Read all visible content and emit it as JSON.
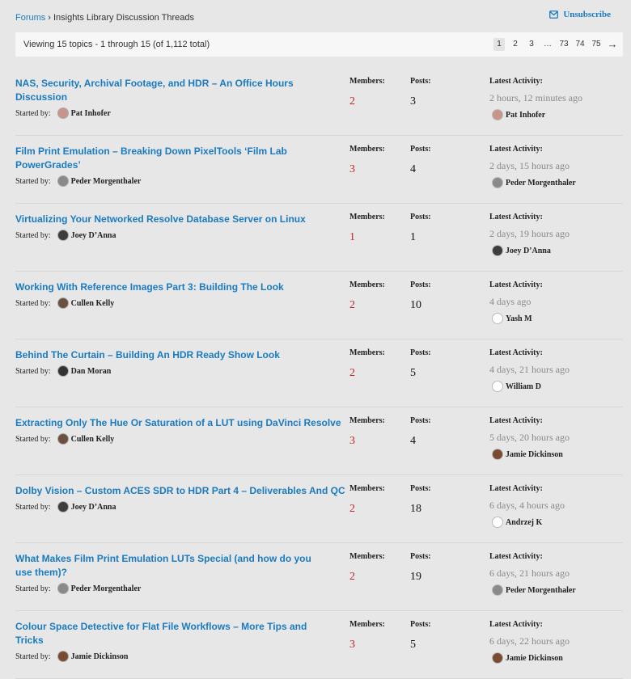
{
  "breadcrumb": {
    "root": "Forums",
    "separator": "›",
    "current": "Insights Library Discussion Threads"
  },
  "subscribe": {
    "label": "Unsubscribe"
  },
  "pagination": {
    "summary": "Viewing 15 topics - 1 through 15 (of 1,112 total)",
    "pages": [
      "1",
      "2",
      "3",
      "…",
      "73",
      "74",
      "75"
    ],
    "current": "1",
    "next": "→"
  },
  "columns": {
    "started_by": "Started by:",
    "members": "Members:",
    "posts": "Posts:",
    "latest": "Latest Activity:"
  },
  "colors": {
    "link": "#1a7bc0",
    "members": "#c0262c",
    "muted": "#8a8a8a"
  },
  "topics": [
    {
      "title": "NAS, Security, Archival Footage, and HDR – An Office Hours Discussion",
      "starter": "Pat Inhofer",
      "starter_avatar": "#c9948a",
      "members": "2",
      "posts": "3",
      "last_time": "2 hours, 12 minutes ago",
      "last_user": "Pat Inhofer",
      "last_avatar": "#c9948a"
    },
    {
      "title": "Film Print Emulation – Breaking Down PixelTools ‘Film Lab PowerGrades’",
      "starter": "Peder Morgenthaler",
      "starter_avatar": "#8a8a8a",
      "members": "3",
      "posts": "4",
      "last_time": "2 days, 15 hours ago",
      "last_user": "Peder Morgenthaler",
      "last_avatar": "#8a8a8a"
    },
    {
      "title": "Virtualizing Your Networked Resolve Database Server on Linux",
      "starter": "Joey D’Anna",
      "starter_avatar": "#3d3d3d",
      "members": "1",
      "posts": "1",
      "last_time": "2 days, 19 hours ago",
      "last_user": "Joey D’Anna",
      "last_avatar": "#3d3d3d"
    },
    {
      "title": "Working With Reference Images Part 3: Building The Look",
      "starter": "Cullen Kelly",
      "starter_avatar": "#6b5040",
      "members": "2",
      "posts": "10",
      "last_time": "4 days ago",
      "last_user": "Yash M",
      "last_avatar": "#ffffff"
    },
    {
      "title": "Behind The Curtain – Building An HDR Ready Show Look",
      "starter": "Dan Moran",
      "starter_avatar": "#333333",
      "members": "2",
      "posts": "5",
      "last_time": "4 days, 21 hours ago",
      "last_user": "William D",
      "last_avatar": "#ffffff"
    },
    {
      "title": "Extracting Only The Hue Or Saturation of a LUT using DaVinci Resolve",
      "starter": "Cullen Kelly",
      "starter_avatar": "#6b5040",
      "members": "3",
      "posts": "4",
      "last_time": "5 days, 20 hours ago",
      "last_user": "Jamie Dickinson",
      "last_avatar": "#7a4a32"
    },
    {
      "title": "Dolby Vision – Custom ACES SDR to HDR Part 4 – Deliverables And QC",
      "starter": "Joey D’Anna",
      "starter_avatar": "#3d3d3d",
      "members": "2",
      "posts": "18",
      "last_time": "6 days, 4 hours ago",
      "last_user": "Andrzej K",
      "last_avatar": "#ffffff"
    },
    {
      "title": "What Makes Film Print Emulation LUTs Special (and how do you use them)?",
      "starter": "Peder Morgenthaler",
      "starter_avatar": "#8a8a8a",
      "members": "2",
      "posts": "19",
      "last_time": "6 days, 21 hours ago",
      "last_user": "Peder Morgenthaler",
      "last_avatar": "#8a8a8a"
    },
    {
      "title": "Colour Space Detective for Flat File Workflows – More Tips and Tricks",
      "starter": "Jamie Dickinson",
      "starter_avatar": "#7a4a32",
      "members": "3",
      "posts": "5",
      "last_time": "6 days, 22 hours ago",
      "last_user": "Jamie Dickinson",
      "last_avatar": "#7a4a32"
    }
  ]
}
